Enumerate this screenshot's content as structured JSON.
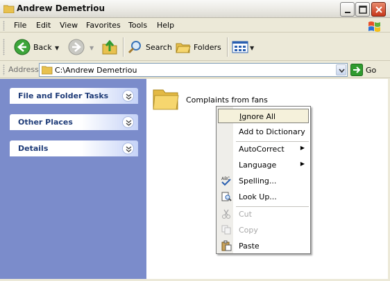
{
  "window": {
    "title": "Andrew Demetriou"
  },
  "menubar": {
    "items": [
      "File",
      "Edit",
      "View",
      "Favorites",
      "Tools",
      "Help"
    ]
  },
  "toolbar": {
    "back_label": "Back",
    "search_label": "Search",
    "folders_label": "Folders"
  },
  "addressbar": {
    "label": "Address",
    "path": "C:\\Andrew Demetriou",
    "go_label": "Go"
  },
  "sidebar": {
    "panels": [
      {
        "title": "File and Folder Tasks"
      },
      {
        "title": "Other Places"
      },
      {
        "title": "Details"
      }
    ]
  },
  "content": {
    "items": [
      {
        "name": "Complaints from fans",
        "icon": "folder-icon"
      }
    ]
  },
  "context_menu": {
    "items": [
      {
        "label": "Ignore All",
        "accel": "I",
        "rest": "gnore All",
        "highlighted": true
      },
      {
        "label": "Add to Dictionary"
      },
      {
        "label": "AutoCorrect",
        "submenu": true
      },
      {
        "label": "Language",
        "submenu": true
      },
      {
        "label": "Spelling...",
        "icon": "spelling-icon"
      },
      {
        "label": "Look Up...",
        "icon": "lookup-icon"
      },
      {
        "label": "Cut",
        "icon": "cut-icon",
        "disabled": true
      },
      {
        "label": "Copy",
        "icon": "copy-icon",
        "disabled": true
      },
      {
        "label": "Paste",
        "icon": "paste-icon"
      }
    ]
  },
  "colors": {
    "sidebar_bg": "#7b8ccb",
    "highlight": "#f5f1db",
    "go_green": "#2f9a2f"
  }
}
